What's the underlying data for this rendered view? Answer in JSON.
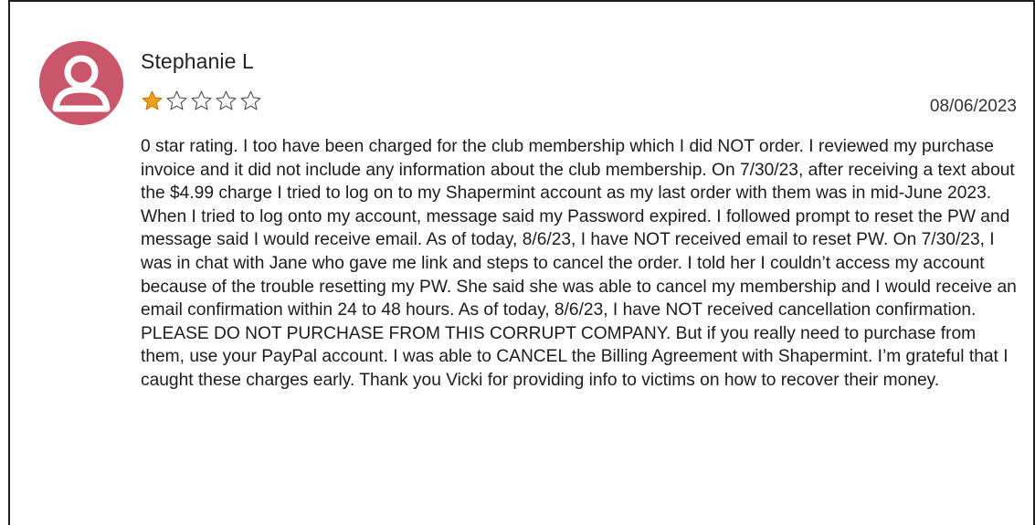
{
  "review": {
    "reviewer_name": "Stephanie L",
    "rating": 1,
    "max_rating": 5,
    "star_color": "#e9a21c",
    "avatar_color": "#c9566a",
    "date": "08/06/2023",
    "text": "0 star rating. I too have been charged for the club membership which I did NOT order. I reviewed my purchase invoice and it did not include any information about the club membership. On 7/30/23, after receiving a text about the $4.99 charge I tried to log on to my Shapermint account as my last order with them was in mid-June 2023. When I tried to log onto my account, message said my Password expired. I followed prompt to reset the PW and message said I would receive email. As of today, 8/6/23, I have NOT received email to reset PW. On 7/30/23, I was in chat with Jane who gave me link and steps to cancel the order. I told her I couldn’t access my account because of the trouble resetting my PW. She said she was able to cancel my membership and I would receive an email confirmation within 24 to 48 hours. As of today, 8/6/23, I have NOT received cancellation confirmation. PLEASE DO NOT PURCHASE FROM THIS CORRUPT COMPANY. But if you really need to purchase from them, use your PayPal account. I was able to CANCEL the Billing Agreement with Shapermint. I’m grateful that I caught these charges early. Thank you Vicki for providing info to victims on how to recover their money."
  }
}
